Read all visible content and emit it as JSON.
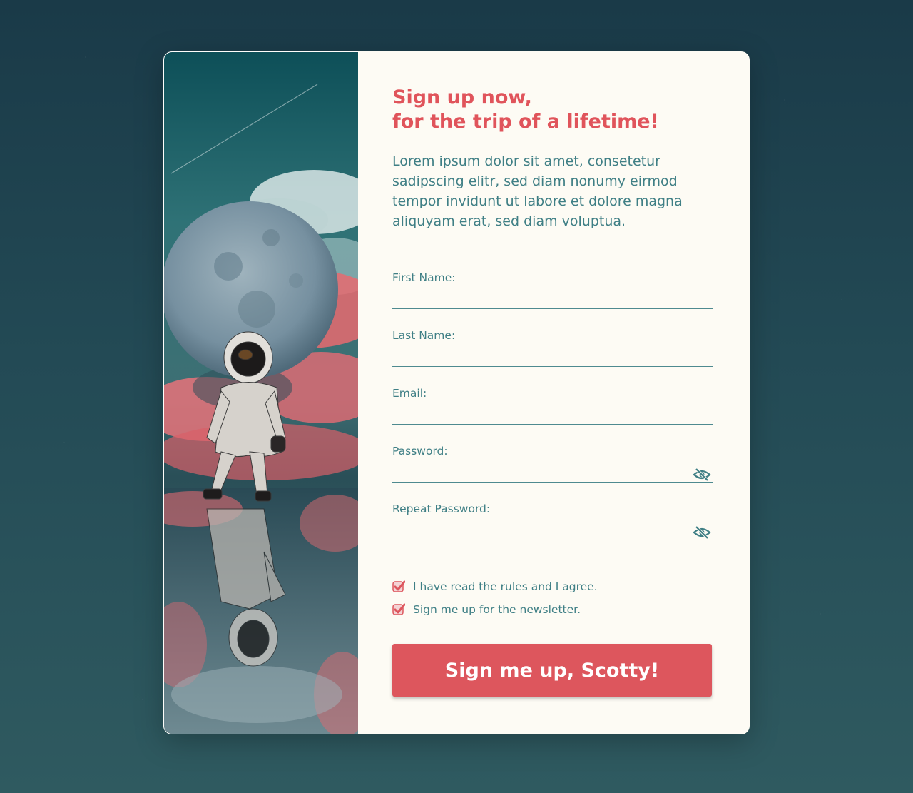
{
  "colors": {
    "accent": "#dd565d",
    "heading": "#e0545b",
    "text": "#3f7f85",
    "card_bg": "#fdfbf4",
    "page_bg": "#234a55"
  },
  "heading": {
    "line1": "Sign up now,",
    "line2": "for the trip of a lifetime!"
  },
  "intro": "Lorem ipsum dolor sit amet, consetetur sadipscing elitr, sed diam nonumy eirmod tempor invidunt ut labore et dolore magna aliquyam erat, sed diam voluptua.",
  "fields": {
    "first_name": {
      "label": "First Name:",
      "value": ""
    },
    "last_name": {
      "label": "Last Name:",
      "value": ""
    },
    "email": {
      "label": "Email:",
      "value": ""
    },
    "password": {
      "label": "Password:",
      "value": "",
      "toggle_icon": "eye-off-icon"
    },
    "repeat_password": {
      "label": "Repeat Password:",
      "value": "",
      "toggle_icon": "eye-off-icon"
    }
  },
  "checkboxes": {
    "rules": {
      "label": "I have read the rules and I agree.",
      "checked": true
    },
    "newsletter": {
      "label": "Sign me up for the newsletter.",
      "checked": true
    }
  },
  "submit": {
    "label": "Sign me up, Scotty!"
  }
}
